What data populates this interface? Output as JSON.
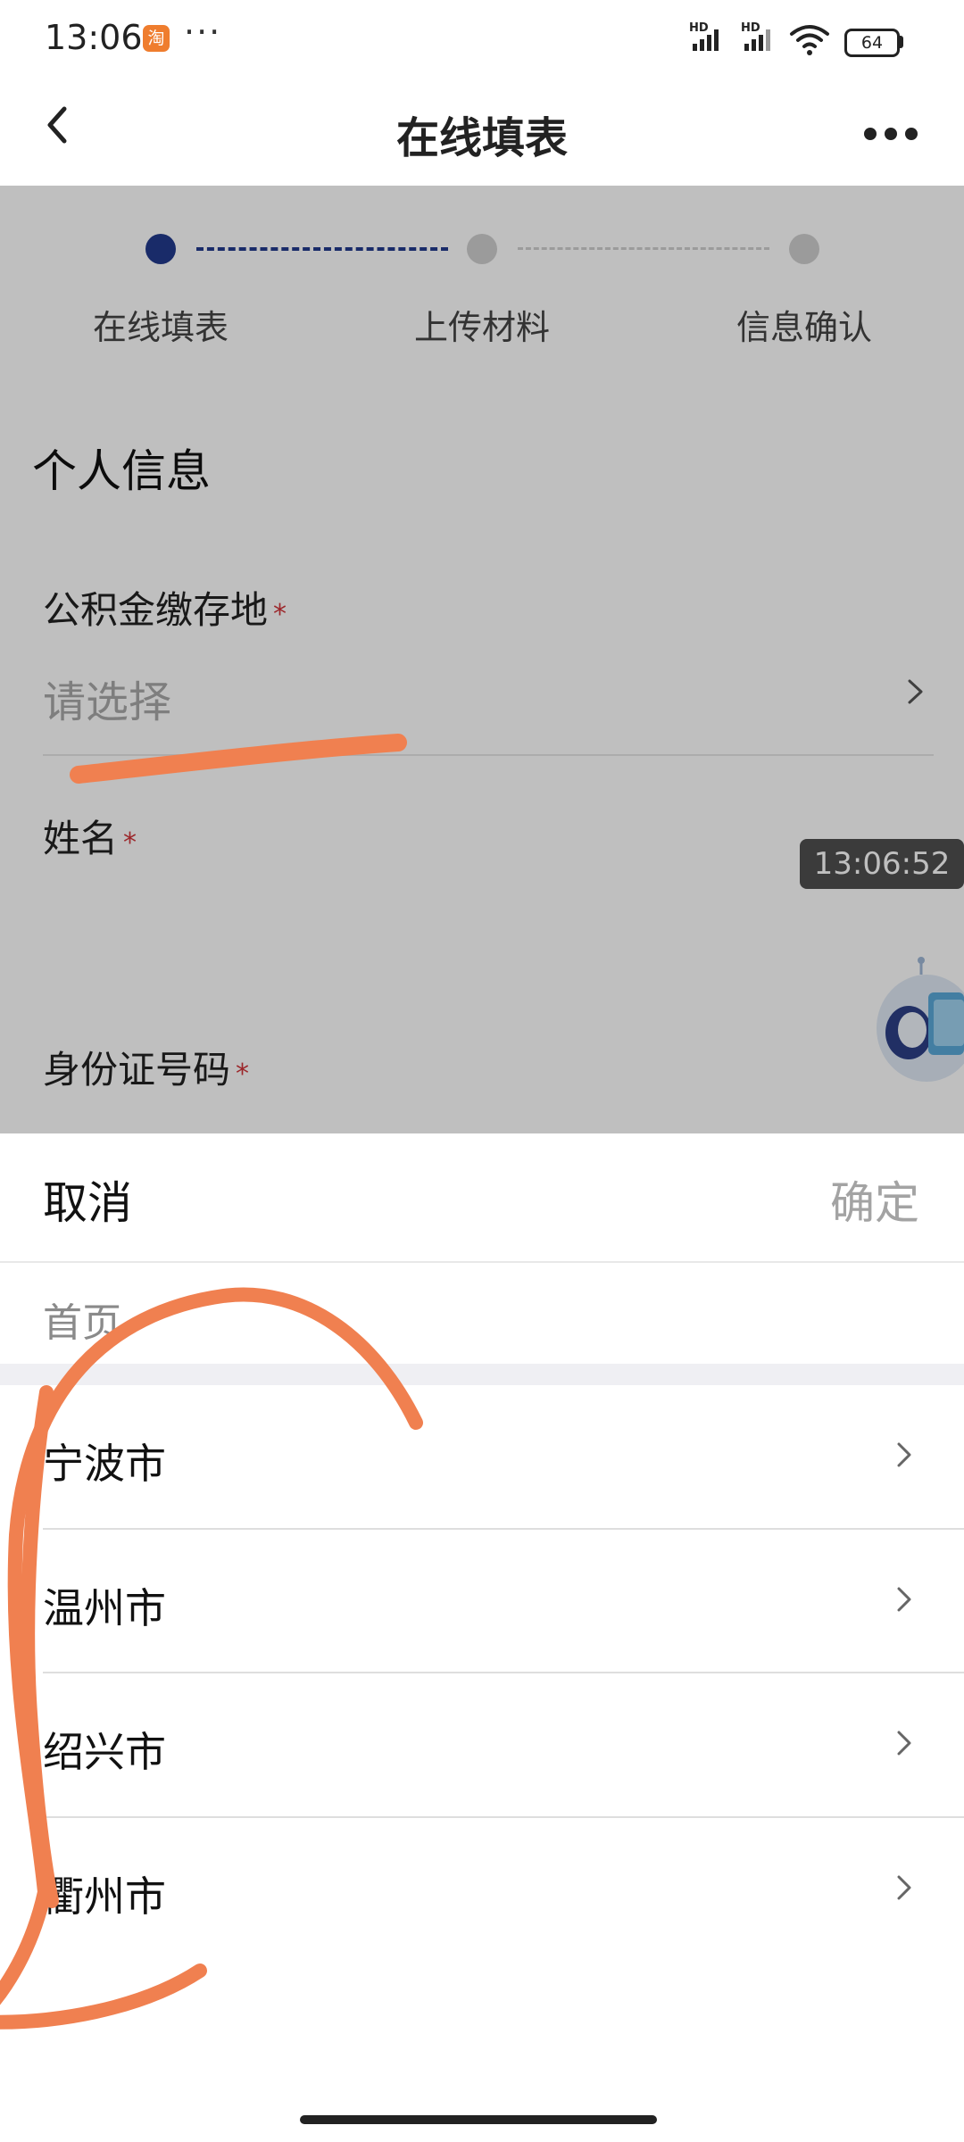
{
  "status_bar": {
    "time": "13:06",
    "app_icon_glyph": "淘",
    "more": "···",
    "signal_1_label": "HD",
    "signal_2_label": "HD",
    "battery": "64"
  },
  "header": {
    "title": "在线填表",
    "back_icon": "chevron-left-icon",
    "more_icon": "more-horizontal-icon"
  },
  "steps": [
    {
      "label": "在线填表",
      "state": "active"
    },
    {
      "label": "上传材料",
      "state": "pending"
    },
    {
      "label": "信息确认",
      "state": "pending"
    }
  ],
  "form": {
    "section_title": "个人信息",
    "fields": [
      {
        "label": "公积金缴存地",
        "required_mark": "*",
        "placeholder": "请选择"
      },
      {
        "label": "姓名",
        "required_mark": "*"
      },
      {
        "label": "身份证号码",
        "required_mark": "*"
      }
    ]
  },
  "time_badge": "13:06:52",
  "picker": {
    "cancel_label": "取消",
    "confirm_label": "确定",
    "breadcrumb": "首页",
    "cities": [
      "宁波市",
      "温州市",
      "绍兴市",
      "衢州市"
    ]
  },
  "colors": {
    "accent": "#223a8c",
    "required": "#d0353a",
    "annotation": "#f08050",
    "overlay": "rgba(0,0,0,0.25)"
  }
}
